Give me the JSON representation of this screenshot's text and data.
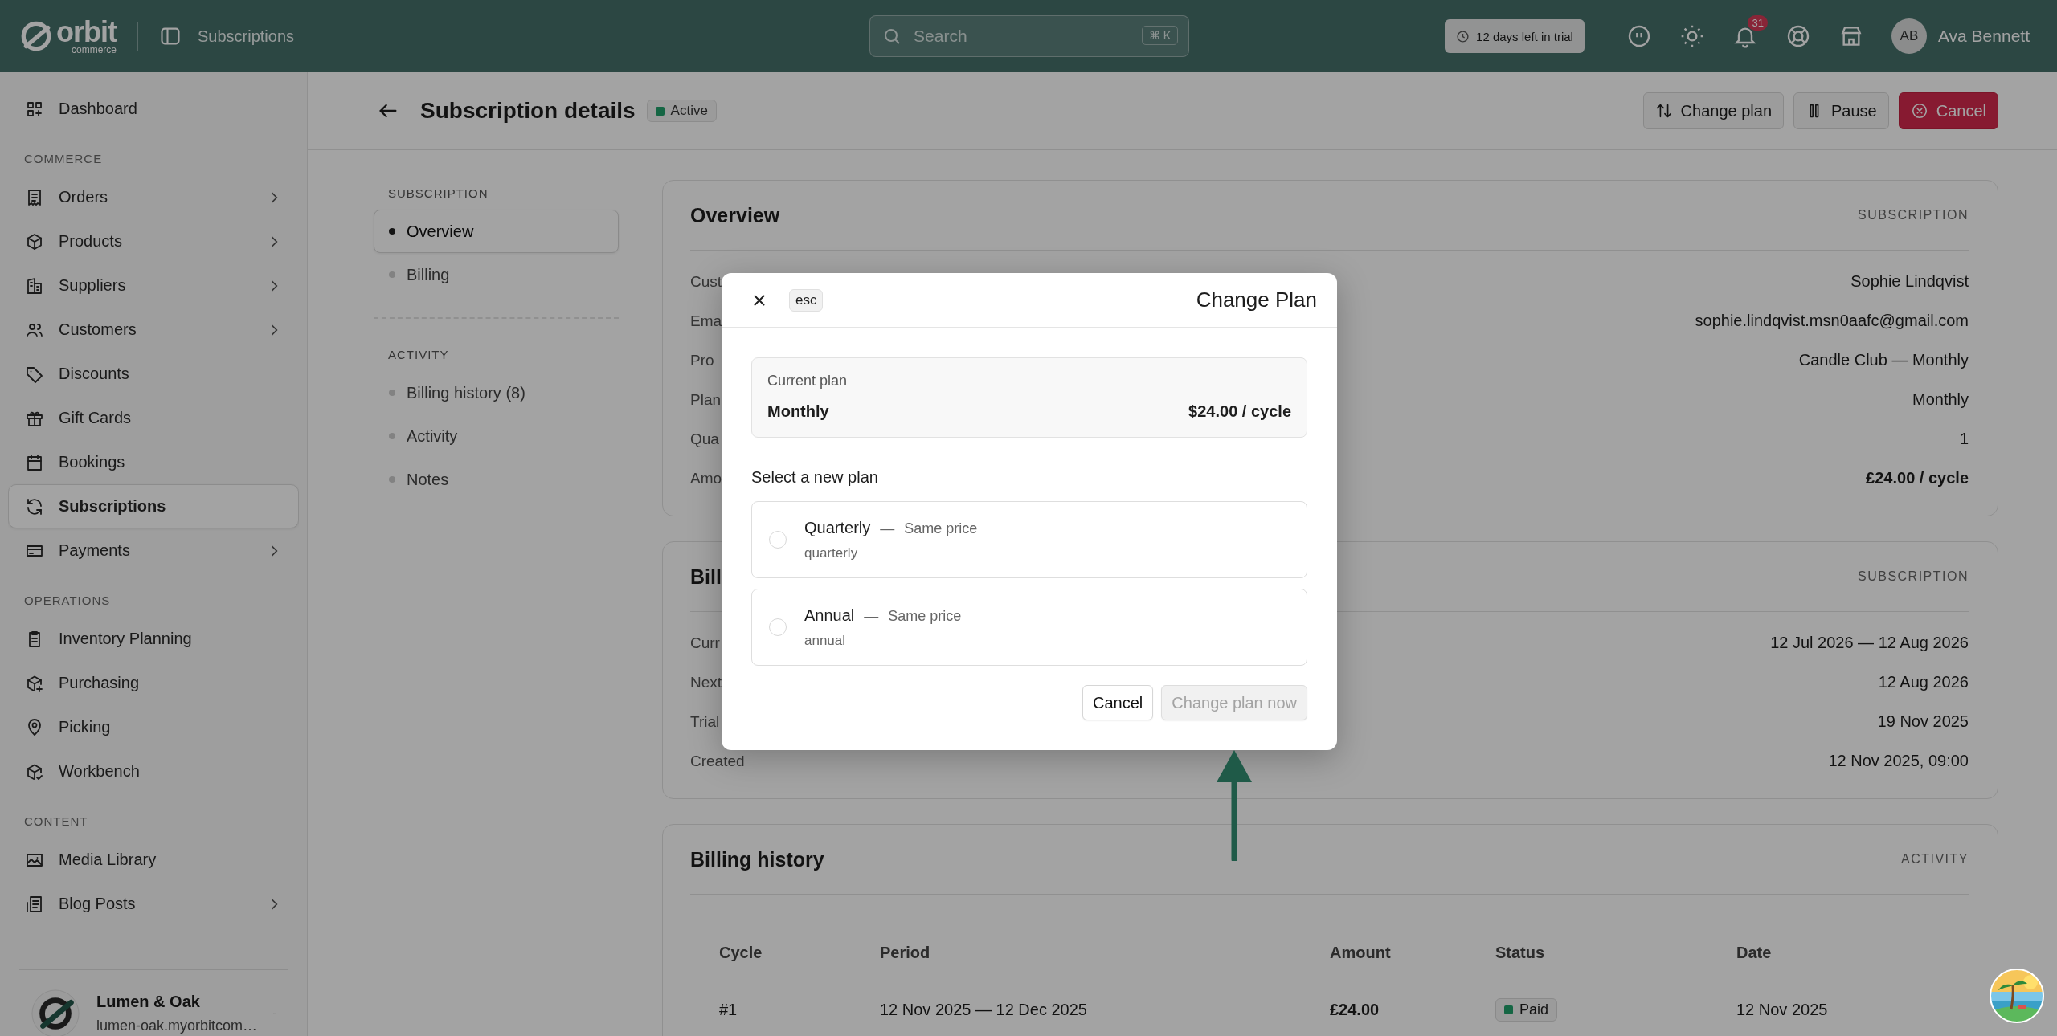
{
  "topbar": {
    "brand": {
      "name": "orbit",
      "tagline": "commerce"
    },
    "breadcrumb": "Subscriptions",
    "search": {
      "placeholder": "Search",
      "shortcut": "⌘ K"
    },
    "trial": "12 days left in trial",
    "notifications": "31",
    "user": {
      "initials": "AB",
      "name": "Ava Bennett"
    }
  },
  "sidebar": {
    "groups": [
      {
        "items": [
          {
            "label": "Dashboard",
            "selected": false,
            "expandable": false
          }
        ]
      },
      {
        "heading": "COMMERCE",
        "items": [
          {
            "label": "Orders",
            "selected": false,
            "expandable": true
          },
          {
            "label": "Products",
            "selected": false,
            "expandable": true
          },
          {
            "label": "Suppliers",
            "selected": false,
            "expandable": true
          },
          {
            "label": "Customers",
            "selected": false,
            "expandable": true
          },
          {
            "label": "Discounts",
            "selected": false,
            "expandable": false
          },
          {
            "label": "Gift Cards",
            "selected": false,
            "expandable": false
          },
          {
            "label": "Bookings",
            "selected": false,
            "expandable": false
          },
          {
            "label": "Subscriptions",
            "selected": true,
            "expandable": false
          },
          {
            "label": "Payments",
            "selected": false,
            "expandable": true
          }
        ]
      },
      {
        "heading": "OPERATIONS",
        "items": [
          {
            "label": "Inventory Planning",
            "selected": false,
            "expandable": false
          },
          {
            "label": "Purchasing",
            "selected": false,
            "expandable": false
          },
          {
            "label": "Picking",
            "selected": false,
            "expandable": false
          },
          {
            "label": "Workbench",
            "selected": false,
            "expandable": false
          }
        ]
      },
      {
        "heading": "CONTENT",
        "items": [
          {
            "label": "Media Library",
            "selected": false,
            "expandable": false
          },
          {
            "label": "Blog Posts",
            "selected": false,
            "expandable": true
          }
        ]
      }
    ],
    "store": {
      "name": "Lumen & Oak",
      "domain": "lumen-oak.myorbitcom…"
    }
  },
  "header": {
    "title": "Subscription details",
    "status": "Active",
    "actions": [
      {
        "label": "Change plan",
        "kind": "default"
      },
      {
        "label": "Pause",
        "kind": "default"
      },
      {
        "label": "Cancel",
        "kind": "danger"
      }
    ]
  },
  "subnav": [
    {
      "heading": "SUBSCRIPTION",
      "items": [
        {
          "label": "Overview",
          "selected": true
        },
        {
          "label": "Billing",
          "selected": false
        }
      ]
    },
    {
      "heading": "ACTIVITY",
      "items": [
        {
          "label": "Billing history (8)",
          "selected": false
        },
        {
          "label": "Activity",
          "selected": false
        },
        {
          "label": "Notes",
          "selected": false
        }
      ]
    }
  ],
  "cards": [
    {
      "title": "Overview",
      "tag": "SUBSCRIPTION",
      "rows": [
        {
          "label": "Cust",
          "value": "Sophie Lindqvist",
          "emphasis": false
        },
        {
          "label": "Ema",
          "value": "sophie.lindqvist.msn0aafc@gmail.com",
          "emphasis": false
        },
        {
          "label": "Pro",
          "value": "Candle Club — Monthly",
          "emphasis": false
        },
        {
          "label": "Plan",
          "value": "Monthly",
          "emphasis": false
        },
        {
          "label": "Qua",
          "value": "1",
          "emphasis": false
        },
        {
          "label": "Amo",
          "value": "£24.00 / cycle",
          "emphasis": true
        }
      ]
    },
    {
      "title": "Bill",
      "tag": "SUBSCRIPTION",
      "rows": [
        {
          "label": "Curr",
          "value": "12 Jul 2026 — 12 Aug 2026",
          "emphasis": false
        },
        {
          "label": "Next",
          "value": "12 Aug 2026",
          "emphasis": false
        },
        {
          "label": "Trial",
          "value": "19 Nov 2025",
          "emphasis": false
        },
        {
          "label": "Created",
          "value": "12 Nov 2025, 09:00",
          "emphasis": false
        }
      ]
    }
  ],
  "billing_history": {
    "title": "Billing history",
    "tag": "ACTIVITY",
    "columns": [
      "Cycle",
      "Period",
      "Amount",
      "Status",
      "Date"
    ],
    "rows": [
      {
        "cycle": "#1",
        "period": "12 Nov 2025 — 12 Dec 2025",
        "amount": "£24.00",
        "status": "Paid",
        "date": "12 Nov 2025"
      }
    ]
  },
  "modal": {
    "title": "Change Plan",
    "esc": "esc",
    "current": {
      "label": "Current plan",
      "name": "Monthly",
      "price": "$24.00 / cycle"
    },
    "prompt": "Select a new plan",
    "options": [
      {
        "name": "Quarterly",
        "separator": "—",
        "note": "Same price",
        "detail": "quarterly",
        "selected": false
      },
      {
        "name": "Annual",
        "separator": "—",
        "note": "Same price",
        "detail": "annual",
        "selected": false
      }
    ],
    "buttons": [
      {
        "label": "Cancel",
        "kind": "secondary",
        "disabled": false
      },
      {
        "label": "Change plan now",
        "kind": "primary",
        "disabled": true
      }
    ]
  }
}
